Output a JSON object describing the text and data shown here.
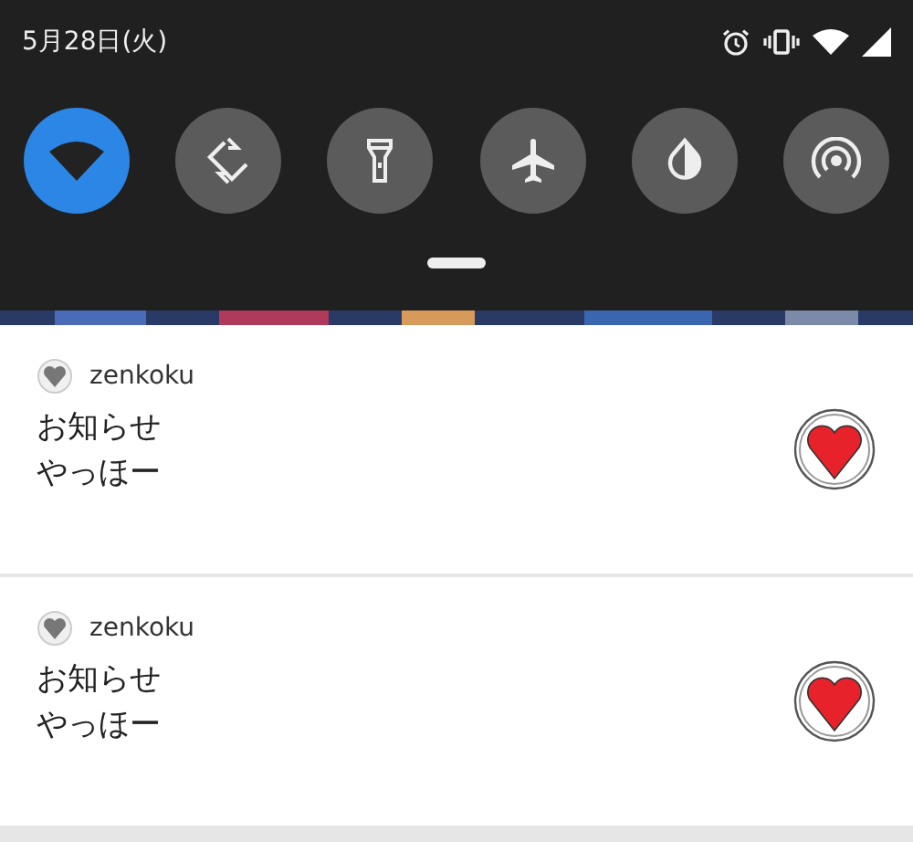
{
  "status_bar": {
    "date": "5月28日(火)"
  },
  "quick_tiles": [
    {
      "kind": "wifi",
      "on": true
    },
    {
      "kind": "rotate",
      "on": false
    },
    {
      "kind": "flashlight",
      "on": false
    },
    {
      "kind": "airplane",
      "on": false
    },
    {
      "kind": "saver",
      "on": false
    },
    {
      "kind": "hotspot",
      "on": false
    }
  ],
  "notifications": [
    {
      "app": "zenkoku",
      "title": "お知らせ",
      "text": "やっほー"
    },
    {
      "app": "zenkoku",
      "title": "お知らせ",
      "text": "やっほー"
    }
  ]
}
